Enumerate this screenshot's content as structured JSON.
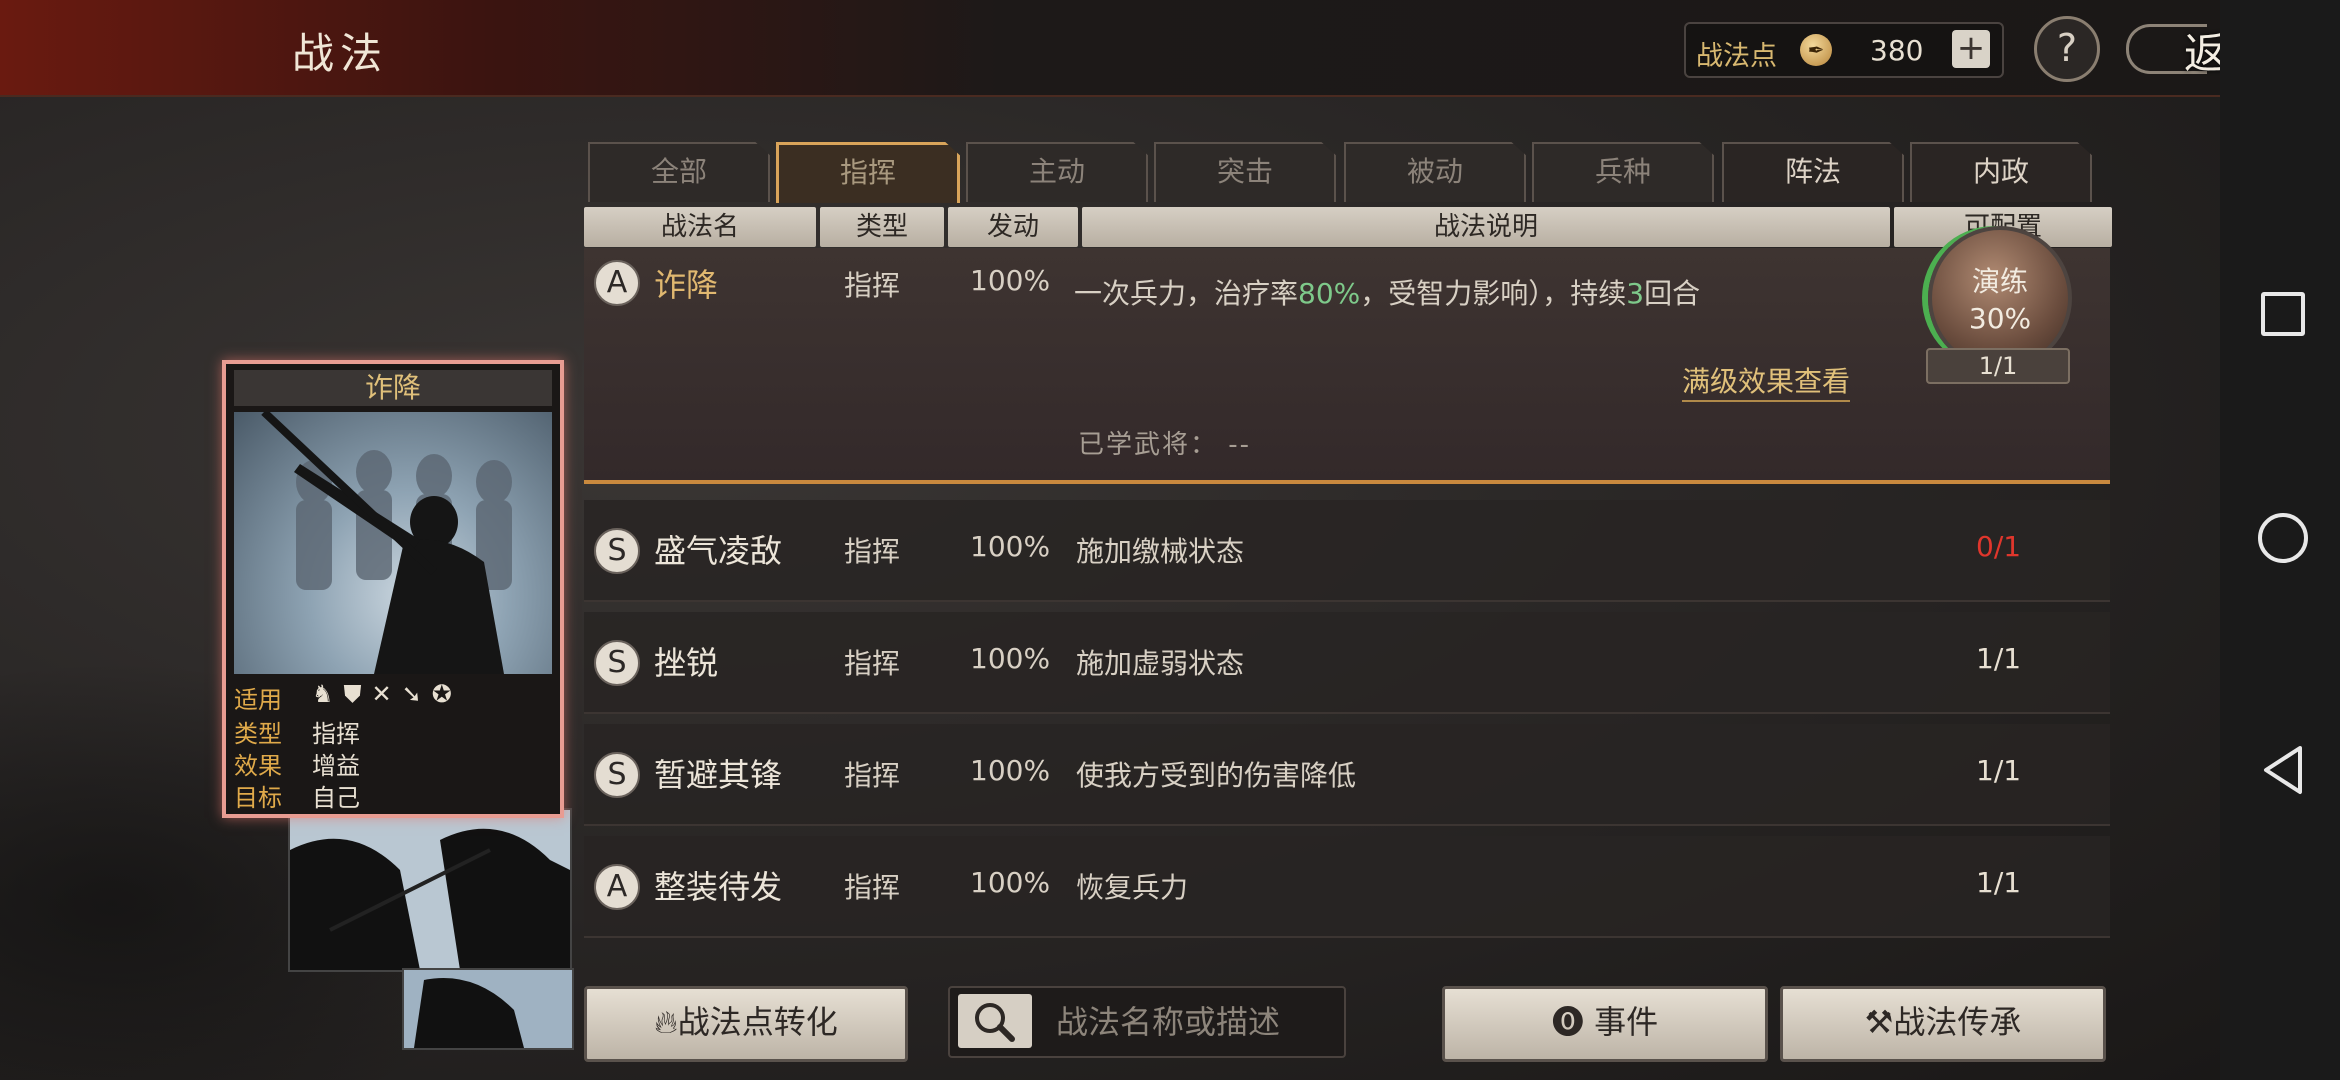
{
  "header": {
    "title": "战法",
    "points_label": "战法点",
    "points_value": "380",
    "plus_label": "+",
    "help_label": "?",
    "back_label": "返回"
  },
  "tabs": [
    {
      "label": "全部",
      "state": "normal"
    },
    {
      "label": "指挥",
      "state": "active"
    },
    {
      "label": "主动",
      "state": "normal"
    },
    {
      "label": "突击",
      "state": "normal"
    },
    {
      "label": "被动",
      "state": "normal"
    },
    {
      "label": "兵种",
      "state": "normal"
    },
    {
      "label": "阵法",
      "state": "bright"
    },
    {
      "label": "内政",
      "state": "bright"
    }
  ],
  "columns": {
    "name": "战法名",
    "type": "类型",
    "trigger": "发动",
    "description": "战法说明",
    "configurable": "可配置"
  },
  "selected_skill": {
    "grade": "A",
    "name": "诈降",
    "type": "指挥",
    "trigger": "100%",
    "desc_line1_pre": "一次兵力，治疗率",
    "desc_line1_hl1": "80%",
    "desc_line1_mid": "，受智力影响），持续",
    "desc_line1_hl2": "3",
    "desc_line1_post": "回合",
    "practice_label": "演练",
    "practice_percent": "30%",
    "practice_progress": 0.3,
    "practice_count": "1/1",
    "full_effect_link": "满级效果查看",
    "learned_generals": "已学武将：  --"
  },
  "skills": [
    {
      "grade": "S",
      "name": "盛气凌敌",
      "type": "指挥",
      "trigger": "100%",
      "desc": "施加缴械状态",
      "count": "0/1",
      "count_color": "#e0362c"
    },
    {
      "grade": "S",
      "name": "挫锐",
      "type": "指挥",
      "trigger": "100%",
      "desc": "施加虚弱状态",
      "count": "1/1",
      "count_color": "#e8e0d2"
    },
    {
      "grade": "S",
      "name": "暂避其锋",
      "type": "指挥",
      "trigger": "100%",
      "desc": "使我方受到的伤害降低",
      "count": "1/1",
      "count_color": "#e8e0d2"
    },
    {
      "grade": "A",
      "name": "整装待发",
      "type": "指挥",
      "trigger": "100%",
      "desc": "恢复兵力",
      "count": "1/1",
      "count_color": "#e8e0d2"
    }
  ],
  "card": {
    "title": "诈降",
    "applicable_label": "适用",
    "type_label": "类型",
    "type_value": "指挥",
    "effect_label": "效果",
    "effect_value": "增益",
    "target_label": "目标",
    "target_value": "自己",
    "troop_icons": [
      "cavalry-icon",
      "shield-icon",
      "bow-icon",
      "spear-icon",
      "wheel-icon"
    ]
  },
  "bottom": {
    "convert_label": "战法点转化",
    "search_placeholder": "战法名称或描述",
    "event_label": "事件",
    "inherit_label": "战法传承"
  }
}
